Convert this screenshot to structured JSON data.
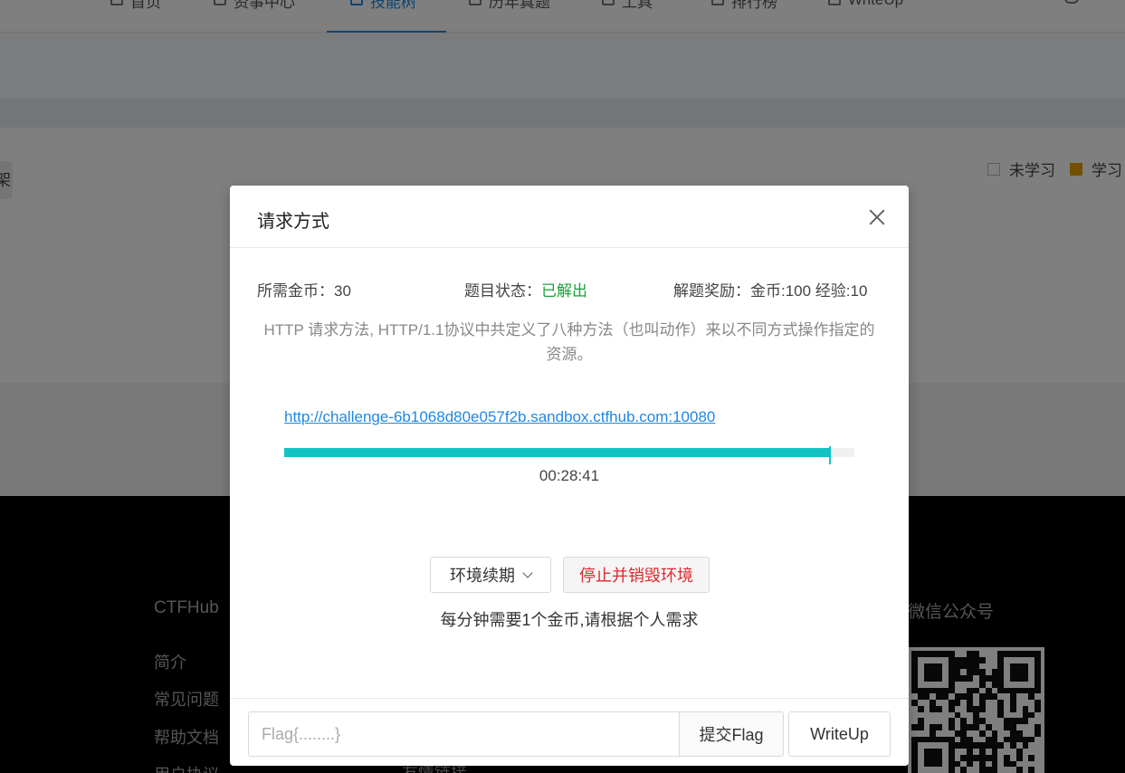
{
  "nav": {
    "items": [
      {
        "label": "首页"
      },
      {
        "label": "资事中心"
      },
      {
        "label": "技能树"
      },
      {
        "label": "历年真题"
      },
      {
        "label": "工具"
      },
      {
        "label": "排行榜"
      },
      {
        "label": "WriteUp"
      }
    ]
  },
  "sidebar_tab": "架",
  "legend": {
    "not_learned": "未学习",
    "learning": "学习"
  },
  "footer": {
    "title": "CTFHub",
    "links": [
      "简介",
      "常见问题",
      "帮助文档",
      "用户协议"
    ],
    "extra_link": "友情链接",
    "wechat_title": "微信公众号"
  },
  "modal": {
    "title": "请求方式",
    "coins_required": "所需金币：30",
    "status_label": "题目状态：",
    "status_value": "已解出",
    "reward": "解题奖励：金币:100 经验:10",
    "description": "HTTP 请求方法, HTTP/1.1协议中共定义了八种方法（也叫动作）来以不同方式操作指定的资源。",
    "env_url": "http://challenge-6b1068d80e057f2b.sandbox.ctfhub.com:10080",
    "progress_fraction": 0.957,
    "timer": "00:28:41",
    "renew_label": "环境续期",
    "destroy_label": "停止并销毁环境",
    "hint": "每分钟需要1个金币,请根据个人需求",
    "flag_placeholder": "Flag{........}",
    "submit_label": "提交Flag",
    "writeup_label": "WriteUp"
  },
  "colors": {
    "accent": "#1e88e5",
    "progress": "#13c2c2",
    "solved": "#15a33a",
    "danger": "#e0282e"
  }
}
